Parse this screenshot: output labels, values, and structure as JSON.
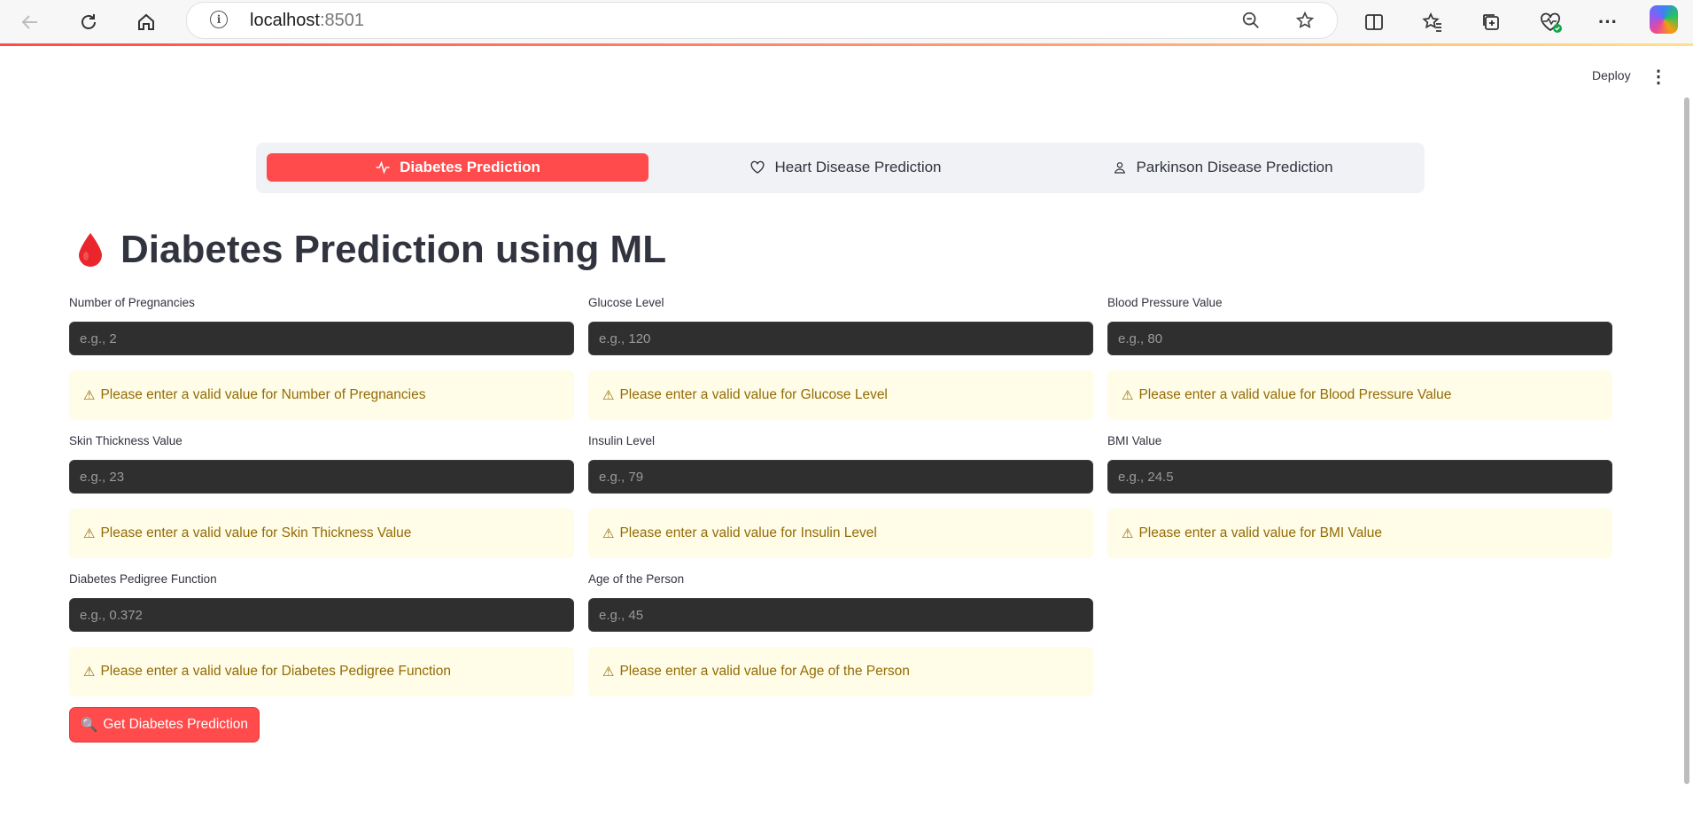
{
  "browser": {
    "url_host": "localhost",
    "url_port": ":8501",
    "back_icon": "arrow-left-icon",
    "reload_icon": "reload-icon",
    "home_icon": "home-icon"
  },
  "header": {
    "deploy_label": "Deploy"
  },
  "tabs": [
    {
      "label": "Diabetes Prediction",
      "icon": "activity-icon",
      "active": true
    },
    {
      "label": "Heart Disease Prediction",
      "icon": "heart-icon",
      "active": false
    },
    {
      "label": "Parkinson Disease Prediction",
      "icon": "person-icon",
      "active": false
    }
  ],
  "page": {
    "title": "Diabetes Prediction using ML",
    "title_icon": "blood-drop-icon"
  },
  "fields": [
    {
      "label": "Number of Pregnancies",
      "placeholder": "e.g., 2",
      "warning": "Please enter a valid value for Number of Pregnancies"
    },
    {
      "label": "Glucose Level",
      "placeholder": "e.g., 120",
      "warning": "Please enter a valid value for Glucose Level"
    },
    {
      "label": "Blood Pressure Value",
      "placeholder": "e.g., 80",
      "warning": "Please enter a valid value for Blood Pressure Value"
    },
    {
      "label": "Skin Thickness Value",
      "placeholder": "e.g., 23",
      "warning": "Please enter a valid value for Skin Thickness Value"
    },
    {
      "label": "Insulin Level",
      "placeholder": "e.g., 79",
      "warning": "Please enter a valid value for Insulin Level"
    },
    {
      "label": "BMI Value",
      "placeholder": "e.g., 24.5",
      "warning": "Please enter a valid value for BMI Value"
    },
    {
      "label": "Diabetes Pedigree Function",
      "placeholder": "e.g., 0.372",
      "warning": "Please enter a valid value for Diabetes Pedigree Function"
    },
    {
      "label": "Age of the Person",
      "placeholder": "e.g., 45",
      "warning": "Please enter a valid value for Age of the Person"
    }
  ],
  "warning_symbol": "⚠",
  "predict_button": {
    "icon": "🔍",
    "label": "Get Diabetes Prediction"
  },
  "colors": {
    "accent": "#ff4b4b",
    "warning_bg": "#fffce7",
    "warning_text": "#926c05",
    "input_bg": "#2f2f2f"
  }
}
